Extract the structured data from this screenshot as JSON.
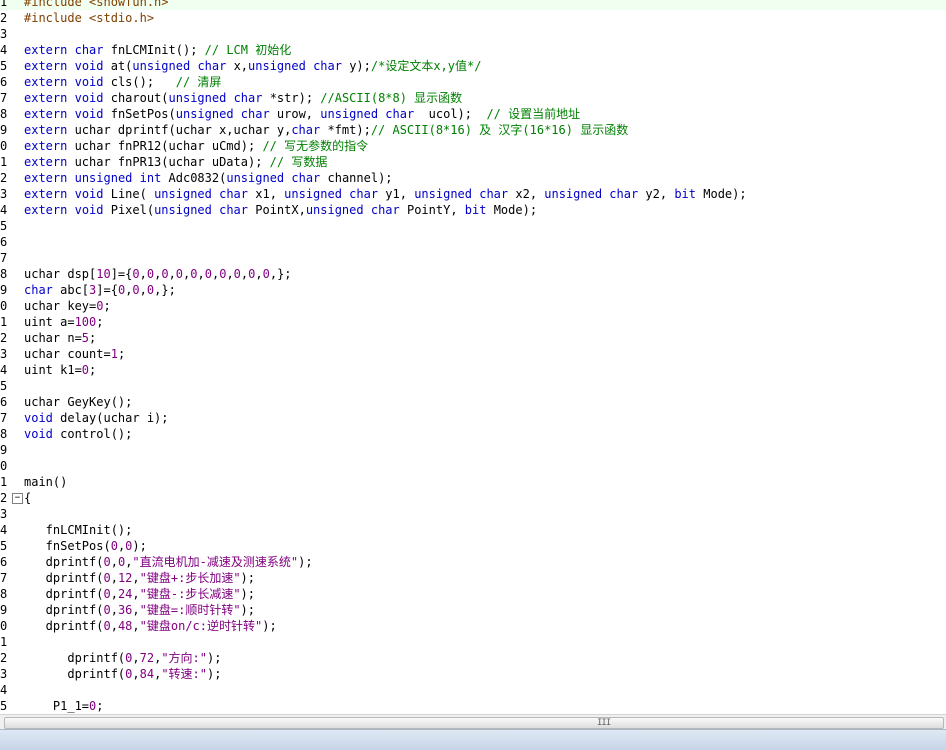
{
  "lines": [
    {
      "n": "1",
      "text": "#include <showfun.h>"
    },
    {
      "n": "2",
      "text": "#include <stdio.h>"
    },
    {
      "n": "3",
      "text": ""
    },
    {
      "n": "4",
      "text": "extern char fnLCMInit(); // LCM 初始化"
    },
    {
      "n": "5",
      "text": "extern void at(unsigned char x,unsigned char y);/*设定文本x,y值*/"
    },
    {
      "n": "6",
      "text": "extern void cls();   // 清屏"
    },
    {
      "n": "7",
      "text": "extern void charout(unsigned char *str); //ASCII(8*8) 显示函数"
    },
    {
      "n": "8",
      "text": "extern void fnSetPos(unsigned char urow, unsigned char  ucol);  // 设置当前地址"
    },
    {
      "n": "9",
      "text": "extern uchar dprintf(uchar x,uchar y,char *fmt);// ASCII(8*16) 及 汉字(16*16) 显示函数"
    },
    {
      "n": "0",
      "text": "extern uchar fnPR12(uchar uCmd); // 写无参数的指令"
    },
    {
      "n": "1",
      "text": "extern uchar fnPR13(uchar uData); // 写数据"
    },
    {
      "n": "2",
      "text": "extern unsigned int Adc0832(unsigned char channel);"
    },
    {
      "n": "3",
      "text": "extern void Line( unsigned char x1, unsigned char y1, unsigned char x2, unsigned char y2, bit Mode);"
    },
    {
      "n": "4",
      "text": "extern void Pixel(unsigned char PointX,unsigned char PointY, bit Mode);"
    },
    {
      "n": "5",
      "text": ""
    },
    {
      "n": "6",
      "text": ""
    },
    {
      "n": "7",
      "text": ""
    },
    {
      "n": "8",
      "text": "uchar dsp[10]={0,0,0,0,0,0,0,0,0,0,};"
    },
    {
      "n": "9",
      "text": "char abc[3]={0,0,0,};"
    },
    {
      "n": "0",
      "text": "uchar key=0;"
    },
    {
      "n": "1",
      "text": "uint a=100;"
    },
    {
      "n": "2",
      "text": "uchar n=5;"
    },
    {
      "n": "3",
      "text": "uchar count=1;"
    },
    {
      "n": "4",
      "text": "uint k1=0;"
    },
    {
      "n": "5",
      "text": ""
    },
    {
      "n": "6",
      "text": "uchar GeyKey();"
    },
    {
      "n": "7",
      "text": "void delay(uchar i);"
    },
    {
      "n": "8",
      "text": "void control();"
    },
    {
      "n": "9",
      "text": ""
    },
    {
      "n": "0",
      "text": ""
    },
    {
      "n": "1",
      "text": "main()"
    },
    {
      "n": "2",
      "text": "{"
    },
    {
      "n": "3",
      "text": ""
    },
    {
      "n": "4",
      "text": "   fnLCMInit();"
    },
    {
      "n": "5",
      "text": "   fnSetPos(0,0);"
    },
    {
      "n": "6",
      "text": "   dprintf(0,0,\"直流电机加-减速及测速系统\");"
    },
    {
      "n": "7",
      "text": "   dprintf(0,12,\"键盘+:步长加速\");"
    },
    {
      "n": "8",
      "text": "   dprintf(0,24,\"键盘-:步长减速\");"
    },
    {
      "n": "9",
      "text": "   dprintf(0,36,\"键盘=:顺时针转\");"
    },
    {
      "n": "0",
      "text": "   dprintf(0,48,\"键盘on/c:逆时针转\");"
    },
    {
      "n": "1",
      "text": ""
    },
    {
      "n": "2",
      "text": "      dprintf(0,72,\"方向:\");"
    },
    {
      "n": "3",
      "text": "      dprintf(0,84,\"转速:\");"
    },
    {
      "n": "4",
      "text": ""
    },
    {
      "n": "5",
      "text": "    P1_1=0;"
    }
  ],
  "fold_marker": "−",
  "scrollbar_grip": "III"
}
